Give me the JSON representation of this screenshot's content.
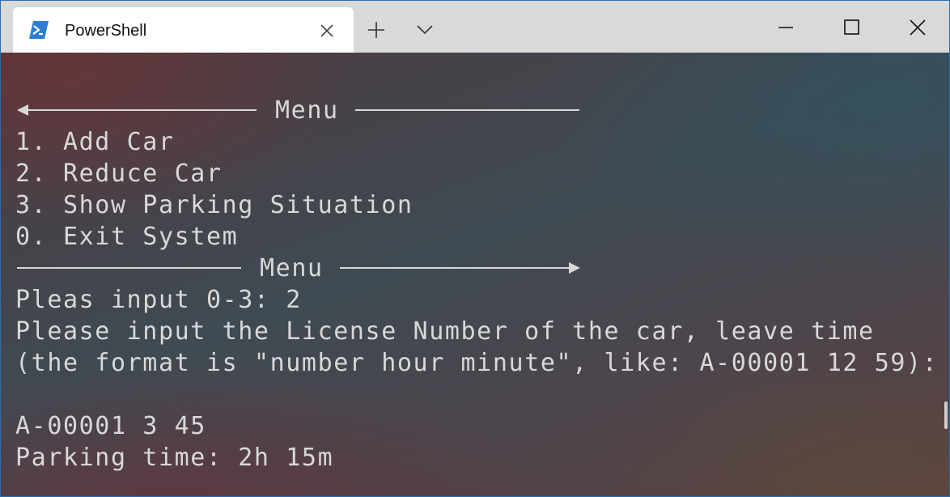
{
  "tab": {
    "title": "PowerShell",
    "icon": "powershell-icon"
  },
  "titlebar_controls": {
    "new_tab": "plus-icon",
    "dropdown": "chevron-down-icon",
    "minimize": "minimize-icon",
    "maximize": "maximize-icon",
    "close": "close-icon"
  },
  "terminal": {
    "menu_top_label": "Menu",
    "menu_items": [
      "1. Add Car",
      "2. Reduce Car",
      "3. Show Parking Situation",
      "0. Exit System"
    ],
    "menu_bottom_label": "Menu",
    "prompt_line": "Pleas input 0-3: 2",
    "instruction_line": "Please input the License Number of the car, leave time",
    "format_line": "(the format is \"number hour minute\", like: A-00001 12 59):",
    "blank_line": "",
    "input_line": "A-00001 3 45",
    "result_line": "Parking time: 2h 15m"
  },
  "colors": {
    "accent": "#2b6cb0",
    "text": "#d8d8d8",
    "titlebar": "#d9d9d9",
    "powershell_blue": "#2d7dd2"
  }
}
